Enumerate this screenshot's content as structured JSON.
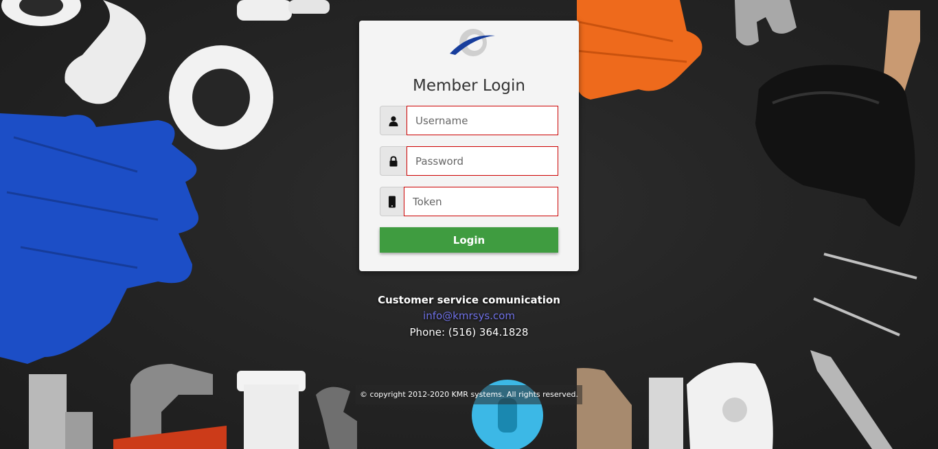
{
  "login": {
    "title": "Member Login",
    "username_placeholder": "Username",
    "password_placeholder": "Password",
    "token_placeholder": "Token",
    "login_label": "Login"
  },
  "contact": {
    "heading": "Customer service comunication",
    "email": "info@kmrsys.com",
    "phone": "Phone: (516) 364.1828"
  },
  "footer": {
    "copyright": "© copyright 2012-2020 KMR systems. All rights reserved."
  },
  "colors": {
    "button": "#3f9c40",
    "field_border": "#cc0000",
    "link": "#6f71e6"
  }
}
